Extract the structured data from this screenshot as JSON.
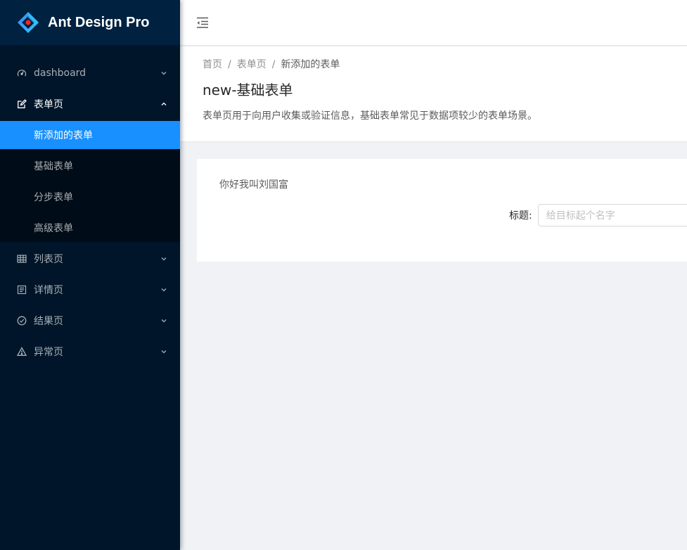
{
  "brand": {
    "title": "Ant Design Pro",
    "colors": {
      "primary": "#1890ff",
      "sider": "#001529",
      "submenu": "#000c17",
      "logo_accent": "#f5222d"
    }
  },
  "sidebar": {
    "items": [
      {
        "label": "dashboard",
        "icon": "dashboard-icon",
        "expanded": false
      },
      {
        "label": "表单页",
        "icon": "form-edit-icon",
        "expanded": true,
        "children": [
          {
            "label": "新添加的表单",
            "selected": true
          },
          {
            "label": "基础表单"
          },
          {
            "label": "分步表单"
          },
          {
            "label": "高级表单"
          }
        ]
      },
      {
        "label": "列表页",
        "icon": "table-icon",
        "expanded": false
      },
      {
        "label": "详情页",
        "icon": "profile-icon",
        "expanded": false
      },
      {
        "label": "结果页",
        "icon": "check-circle-icon",
        "expanded": false
      },
      {
        "label": "异常页",
        "icon": "warning-icon",
        "expanded": false
      }
    ]
  },
  "header": {
    "trigger_icon": "menu-fold-icon"
  },
  "page_header": {
    "breadcrumb": [
      "首页",
      "表单页",
      "新添加的表单"
    ],
    "title": "new-基础表单",
    "description": "表单页用于向用户收集或验证信息，基础表单常见于数据项较少的表单场景。"
  },
  "card": {
    "greeting": "你好我叫刘国富",
    "form": {
      "title_label": "标题:",
      "title_placeholder": "给目标起个名字",
      "title_value": ""
    }
  }
}
